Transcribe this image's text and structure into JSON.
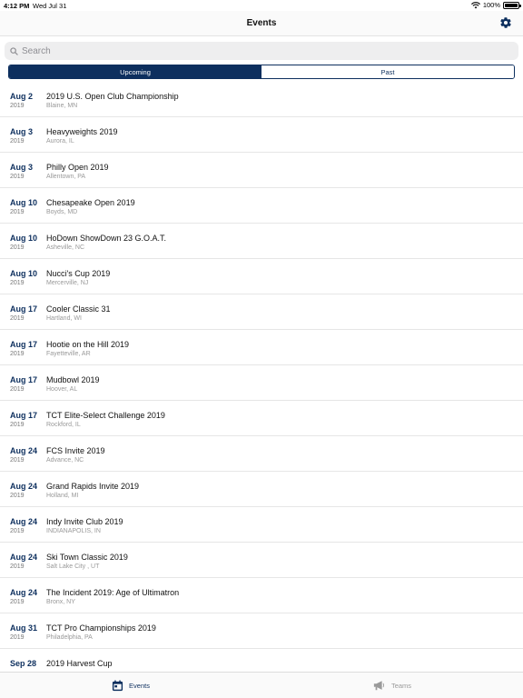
{
  "status_bar": {
    "time": "4:12 PM",
    "date": "Wed Jul 31",
    "battery_text": "100%",
    "battery_level": 1.0
  },
  "nav": {
    "title": "Events",
    "settings_icon": "gear-icon"
  },
  "search": {
    "placeholder": "Search",
    "value": ""
  },
  "segments": [
    {
      "label": "Upcoming",
      "selected": true
    },
    {
      "label": "Past",
      "selected": false
    }
  ],
  "events": [
    {
      "month_day": "Aug 2",
      "year": "2019",
      "name": "2019 U.S. Open Club Championship",
      "location": "Blaine, MN"
    },
    {
      "month_day": "Aug 3",
      "year": "2019",
      "name": "Heavyweights 2019",
      "location": "Aurora, IL"
    },
    {
      "month_day": "Aug 3",
      "year": "2019",
      "name": "Philly Open 2019",
      "location": "Allentown, PA"
    },
    {
      "month_day": "Aug 10",
      "year": "2019",
      "name": "Chesapeake Open 2019",
      "location": "Boyds, MD"
    },
    {
      "month_day": "Aug 10",
      "year": "2019",
      "name": "HoDown ShowDown 23 G.O.A.T.",
      "location": "Asheville, NC"
    },
    {
      "month_day": "Aug 10",
      "year": "2019",
      "name": "Nucci's Cup 2019",
      "location": "Mercerville, NJ"
    },
    {
      "month_day": "Aug 17",
      "year": "2019",
      "name": "Cooler Classic 31",
      "location": "Hartland, WI"
    },
    {
      "month_day": "Aug 17",
      "year": "2019",
      "name": "Hootie on the Hill 2019",
      "location": "Fayetteville, AR"
    },
    {
      "month_day": "Aug 17",
      "year": "2019",
      "name": "Mudbowl 2019",
      "location": "Hoover, AL"
    },
    {
      "month_day": "Aug 17",
      "year": "2019",
      "name": "TCT Elite-Select Challenge 2019",
      "location": "Rockford, IL"
    },
    {
      "month_day": "Aug 24",
      "year": "2019",
      "name": "FCS Invite 2019",
      "location": "Advance, NC"
    },
    {
      "month_day": "Aug 24",
      "year": "2019",
      "name": "Grand Rapids Invite 2019",
      "location": "Holland, MI"
    },
    {
      "month_day": "Aug 24",
      "year": "2019",
      "name": "Indy Invite Club 2019",
      "location": "INDIANAPOLIS, IN"
    },
    {
      "month_day": "Aug 24",
      "year": "2019",
      "name": "Ski Town Classic 2019",
      "location": "Salt Lake City , UT"
    },
    {
      "month_day": "Aug 24",
      "year": "2019",
      "name": "The Incident 2019: Age of Ultimatron",
      "location": "Bronx, NY"
    },
    {
      "month_day": "Aug 31",
      "year": "2019",
      "name": "TCT Pro Championships 2019",
      "location": "Philadelphia, PA"
    },
    {
      "month_day": "Sep 28",
      "year": "",
      "name": "2019 Harvest Cup",
      "location": ""
    }
  ],
  "tabs": [
    {
      "label": "Events",
      "icon": "calendar-icon",
      "active": true
    },
    {
      "label": "Teams",
      "icon": "megaphone-icon",
      "active": false
    }
  ],
  "colors": {
    "accent": "#0d2f5e",
    "inactive_tab": "#9a9a9a"
  }
}
